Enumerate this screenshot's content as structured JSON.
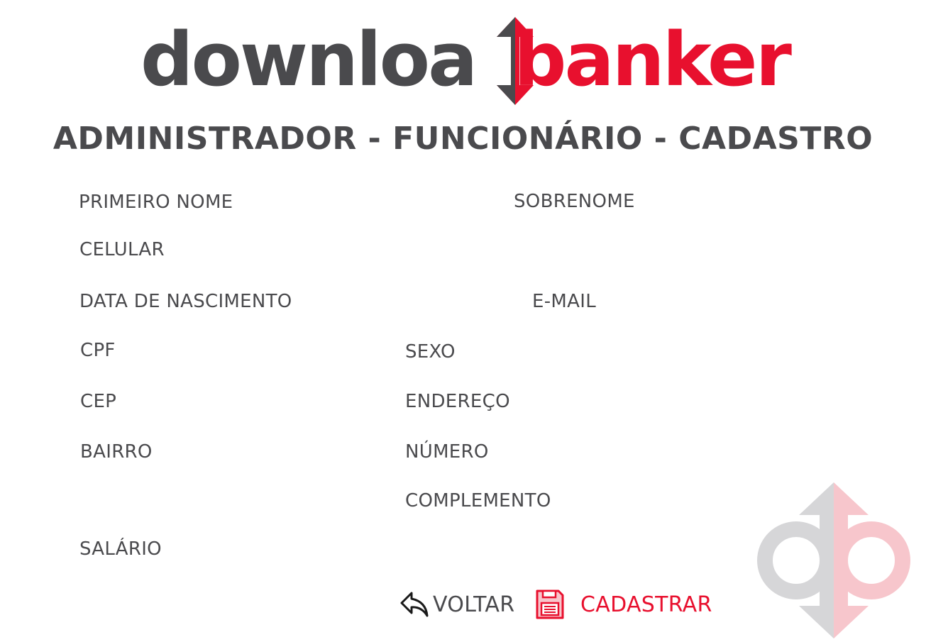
{
  "logo": {
    "text_part_1": "downloa",
    "text_part_2": "banker",
    "color_dark": "#4a4a4d",
    "color_red": "#e8102e"
  },
  "page_title": "ADMINISTRADOR - FUNCIONÁRIO - CADASTRO",
  "form": {
    "first_name": {
      "label": "PRIMEIRO NOME",
      "value": ""
    },
    "last_name": {
      "label": "SOBRENOME",
      "value": ""
    },
    "phone": {
      "label": "CELULAR",
      "value": ""
    },
    "birth_date": {
      "label": "DATA DE NASCIMENTO",
      "value": ""
    },
    "email": {
      "label": "E-MAIL",
      "value": ""
    },
    "cpf": {
      "label": "CPF",
      "value": ""
    },
    "sex": {
      "label": "SEXO",
      "value": ""
    },
    "cep": {
      "label": "CEP",
      "value": ""
    },
    "address": {
      "label": "ENDEREÇO",
      "value": ""
    },
    "neighborhood": {
      "label": "BAIRRO",
      "value": ""
    },
    "number": {
      "label": "NÚMERO",
      "value": ""
    },
    "complement": {
      "label": "COMPLEMENTO",
      "value": ""
    },
    "salary": {
      "label": "SALÁRIO",
      "value": ""
    }
  },
  "actions": {
    "back_label": "VOLTAR",
    "back_icon": "undo-arrow-icon",
    "save_label": "CADASTRAR",
    "save_icon": "floppy-disk-icon"
  },
  "watermark_icon": "db-logo-mark"
}
